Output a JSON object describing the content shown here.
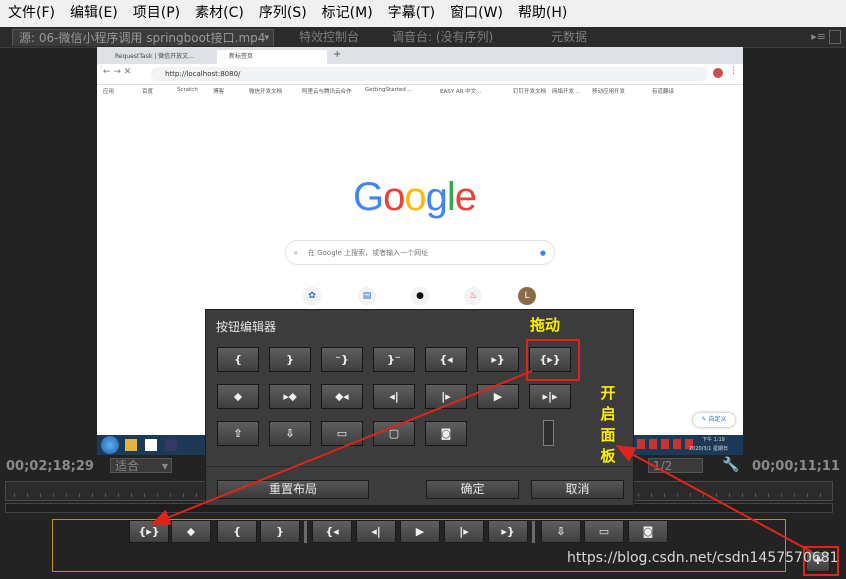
{
  "menu": [
    "文件(F)",
    "编辑(E)",
    "项目(P)",
    "素材(C)",
    "序列(S)",
    "标记(M)",
    "字幕(T)",
    "窗口(W)",
    "帮助(H)"
  ],
  "tabs": [
    {
      "label": "源: 06-微信小程序调用 springboot接口.mp4"
    },
    {
      "label": "特效控制台"
    },
    {
      "label": "调音台: (没有序列)"
    },
    {
      "label": "元数据"
    }
  ],
  "browser": {
    "tabs": [
      "RequestTask | 微信开放文...",
      "新标签页"
    ],
    "url": "http://localhost:8080/",
    "bookmarks": [
      "应用",
      "百度",
      "Scratch",
      "博客",
      "微信开发文档",
      "阿里云与腾讯云合作",
      "GettingStarted ...",
      "EASY AR 中文...",
      "钉钉开发文档",
      "网络开发 ...",
      "移动应用开发",
      "有道翻译"
    ],
    "google": "Google",
    "search_placeholder": "在 Google 上搜索，或者输入一个网址",
    "customize": "自定义",
    "clock": "下午 1:19",
    "date": "2020/3/1 星期日"
  },
  "timecode_left": "00;02;18;29",
  "fit_label": "适合",
  "ratio_label": "1/2",
  "timecode_right": "00;00;11;11",
  "panel": {
    "title": "按钮编辑器",
    "rows": [
      [
        {
          "icon": "mark-in-icon",
          "g": "{"
        },
        {
          "icon": "mark-out-icon",
          "g": "}"
        },
        {
          "icon": "clear-in-icon",
          "g": "⁻}"
        },
        {
          "icon": "clear-out-icon",
          "g": "}⁻"
        },
        {
          "icon": "go-to-in-icon",
          "g": "{◂"
        },
        {
          "icon": "go-to-out-icon",
          "g": "▸}"
        },
        {
          "icon": "play-in-to-out-icon",
          "g": "{▸}"
        }
      ],
      [
        {
          "icon": "add-marker-icon",
          "g": "⬥"
        },
        {
          "icon": "next-marker-icon",
          "g": "▸⬥"
        },
        {
          "icon": "previous-marker-icon",
          "g": "⬥◂"
        },
        {
          "icon": "step-back-icon",
          "g": "◂|"
        },
        {
          "icon": "step-forward-icon",
          "g": "|▸"
        },
        {
          "icon": "play-icon",
          "g": "▶"
        },
        {
          "icon": "play-around-icon",
          "g": "▸|▸"
        }
      ],
      [
        {
          "icon": "export-icon",
          "g": "⇧"
        },
        {
          "icon": "insert-icon",
          "g": "⇩"
        },
        {
          "icon": "overwrite-icon",
          "g": "▭"
        },
        {
          "icon": "safe-margins-icon",
          "g": "▢"
        },
        {
          "icon": "export-frame-icon",
          "g": "◙"
        }
      ]
    ],
    "reset": "重置布局",
    "ok": "确定",
    "cancel": "取消"
  },
  "transport": [
    {
      "icon": "play-in-to-out-icon",
      "g": "{▸}"
    },
    {
      "icon": "add-marker-icon",
      "g": "⬥"
    },
    {
      "icon": "mark-in-icon",
      "g": "{"
    },
    {
      "icon": "mark-out-icon",
      "g": "}"
    },
    {
      "icon": "go-to-in-icon",
      "g": "{◂"
    },
    {
      "icon": "step-back-icon",
      "g": "◂|"
    },
    {
      "icon": "play-icon",
      "g": "▶"
    },
    {
      "icon": "step-forward-icon",
      "g": "|▸"
    },
    {
      "icon": "go-to-out-icon",
      "g": "▸}"
    },
    {
      "icon": "insert-icon",
      "g": "⇩"
    },
    {
      "icon": "overwrite-icon",
      "g": "▭"
    },
    {
      "icon": "export-frame-icon",
      "g": "◙"
    }
  ],
  "annotations": {
    "drag": "拖动",
    "open_panel": "开启面板"
  },
  "watermark": "https://blog.csdn.net/csdn1457570681",
  "colors": {
    "highlight": "#e0241b",
    "annotation": "#ffee00",
    "controls_border": "#b8912a"
  }
}
